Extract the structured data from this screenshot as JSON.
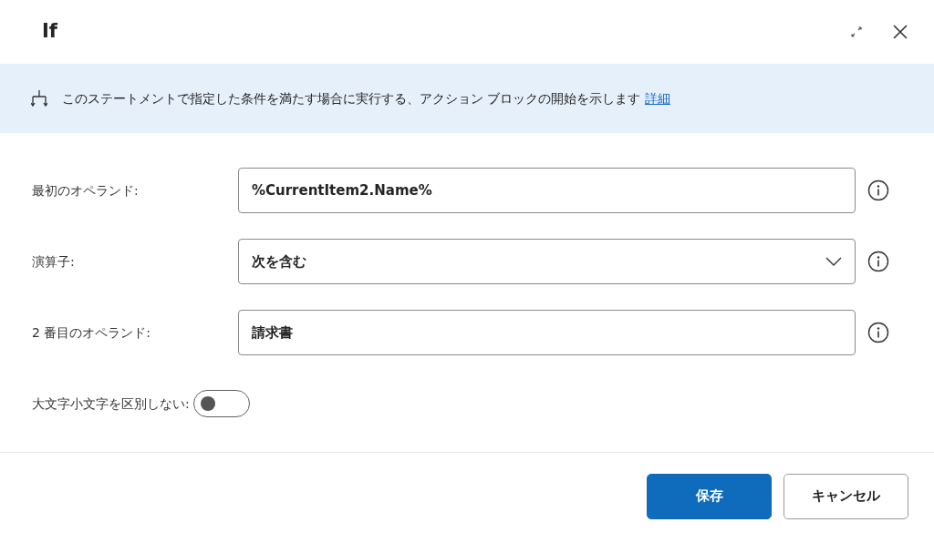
{
  "window": {
    "title": "If"
  },
  "banner": {
    "text": "このステートメントで指定した条件を満たす場合に実行する、アクション ブロックの開始を示します",
    "link": "詳細"
  },
  "fields": [
    {
      "kind": "text",
      "label": "最初のオペランド:",
      "value": "%CurrentItem2.Name%"
    },
    {
      "kind": "dropdown",
      "label": "演算子:",
      "value": "次を含む"
    },
    {
      "kind": "text",
      "label": "2 番目のオペランド:",
      "value": "請求書"
    },
    {
      "kind": "toggle",
      "label": "大文字小文字を区別しない:",
      "on": false
    }
  ],
  "buttons": [
    {
      "label": "保存",
      "primary": true
    },
    {
      "label": "キャンセル",
      "primary": false
    }
  ]
}
